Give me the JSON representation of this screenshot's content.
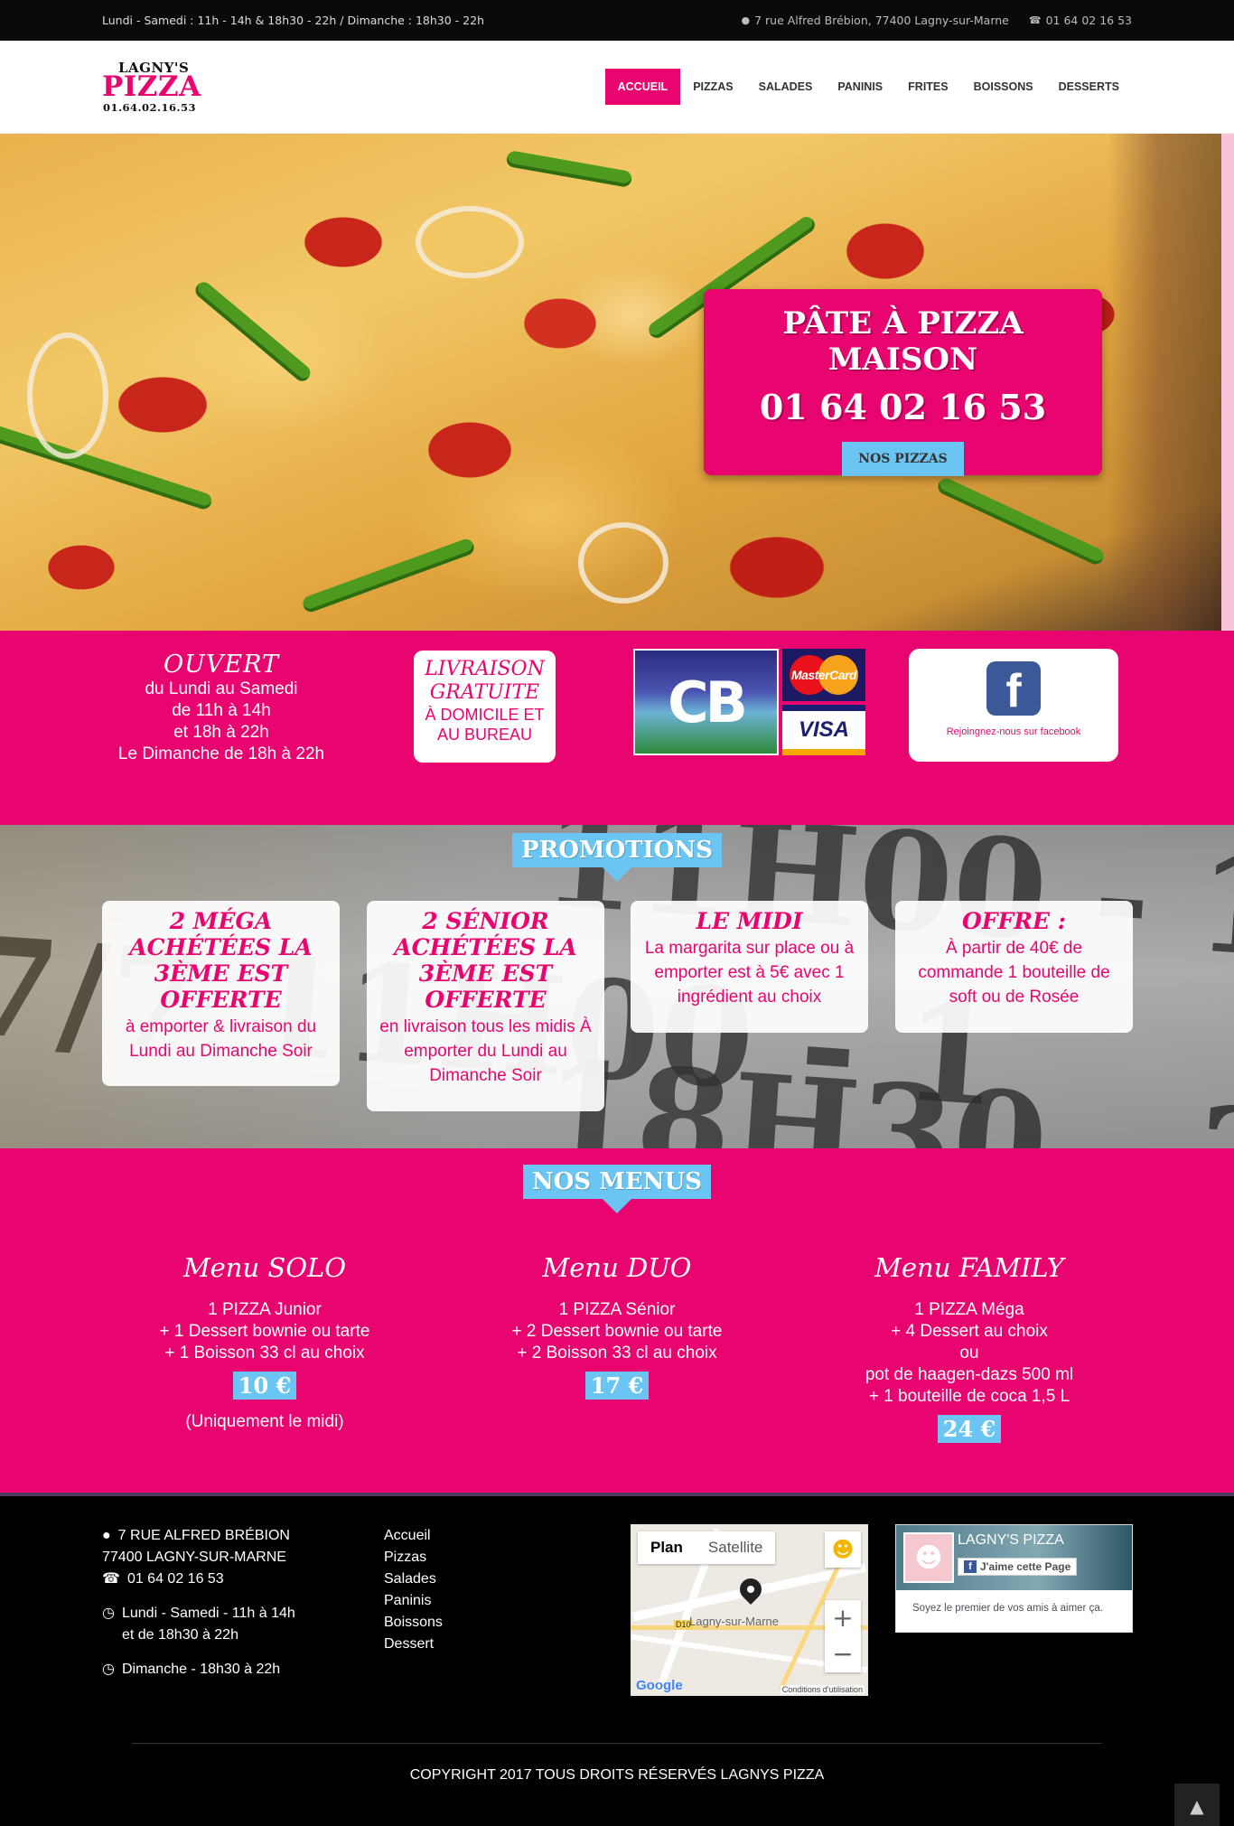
{
  "topbar": {
    "hours": "Lundi - Samedi : 11h - 14h & 18h30 - 22h / Dimanche : 18h30 - 22h",
    "address": "7 rue Alfred Brébion, 77400 Lagny-sur-Marne",
    "phone": "01 64 02 16 53"
  },
  "logo": {
    "line1": "LAGNY'S",
    "line2": "PIZZA",
    "line3": "01.64.02.16.53"
  },
  "nav": {
    "items": [
      {
        "label": "ACCUEIL",
        "active": true
      },
      {
        "label": "PIZZAS"
      },
      {
        "label": "SALADES"
      },
      {
        "label": "PANINIS"
      },
      {
        "label": "FRITES"
      },
      {
        "label": "BOISSONS"
      },
      {
        "label": "DESSERTS"
      }
    ]
  },
  "hero": {
    "title": "PÂTE À PIZZA MAISON",
    "phone": "01 64 02 16 53",
    "button": "NOS PIZZAS"
  },
  "info": {
    "open": {
      "title": "OUVERT",
      "lines": [
        "du Lundi au Samedi",
        "de 11h à 14h",
        "et 18h à 22h",
        "Le Dimanche de 18h à 22h"
      ]
    },
    "delivery": {
      "title1": "LIVRAISON",
      "title2": "GRATUITE",
      "line1": "À DOMICILE ET",
      "line2": "AU BUREAU"
    },
    "cards": {
      "cb": "CB",
      "mastercard": "MasterCard",
      "visa": "VISA"
    },
    "facebook": {
      "text": "Rejoingnez-nous sur facebook"
    }
  },
  "promotions": {
    "tag": "PROMOTIONS",
    "cards": [
      {
        "heading": "2 MÉGA ACHÉTÉES LA 3ÈME EST OFFERTE",
        "text": "à emporter & livraison du Lundi au Dimanche Soir"
      },
      {
        "heading": "2 SÉNIOR ACHÉTÉES LA 3ÈME EST OFFERTE",
        "text": "en livraison tous les midis À emporter du Lundi au Dimanche Soir"
      },
      {
        "heading": "LE MIDI",
        "text": "La margarita sur place ou à emporter est à 5€ avec 1 ingrédient au choix"
      },
      {
        "heading": "OFFRE :",
        "text": "À partir de 40€ de commande 1 bouteille de soft ou de Rosée"
      }
    ]
  },
  "menus": {
    "tag": "NOS MENUS",
    "items": [
      {
        "title": "Menu SOLO",
        "lines": [
          "1 PIZZA Junior",
          "+ 1 Dessert bownie ou tarte",
          "+ 1 Boisson 33 cl au choix"
        ],
        "price": "10 €",
        "note": "(Uniquement le midi)"
      },
      {
        "title": "Menu DUO",
        "lines": [
          "1 PIZZA Sénior",
          "+ 2 Dessert bownie ou tarte",
          "+ 2 Boisson 33 cl au choix"
        ],
        "price": "17 €"
      },
      {
        "title": "Menu FAMILY",
        "lines": [
          "1 PIZZA Méga",
          "+ 4 Dessert au choix",
          "ou",
          "pot de haagen-dazs 500 ml",
          "+ 1 bouteille de coca 1,5 L"
        ],
        "price": "24 €"
      }
    ]
  },
  "footer": {
    "address1": "7 RUE ALFRED BRÉBION",
    "address2": "77400 LAGNY-SUR-MARNE",
    "phone": "01 64 02 16 53",
    "hours1a": "Lundi - Samedi - 11h à 14h",
    "hours1b": "et de 18h30 à 22h",
    "hours2": "Dimanche - 18h30 à 22h",
    "links": [
      "Accueil",
      "Pizzas",
      "Salades",
      "Paninis",
      "Boissons",
      "Dessert"
    ],
    "map": {
      "plan": "Plan",
      "satellite": "Satellite",
      "town": "Lagny-sur-Marne",
      "terms": "Conditions d'utilisation",
      "road": "D10",
      "logo": "Google"
    },
    "fbwidget": {
      "name": "LAGNY'S PIZZA",
      "like": "J'aime cette Page",
      "message": "Soyez le premier de vos amis à aimer ça."
    },
    "copyright": "COPYRIGHT 2017 TOUS DROITS RÉSERVÉS LAGNYS PIZZA"
  },
  "colors": {
    "brand": "#e8056f",
    "accent": "#6ac5f2",
    "dark": "#000000"
  }
}
